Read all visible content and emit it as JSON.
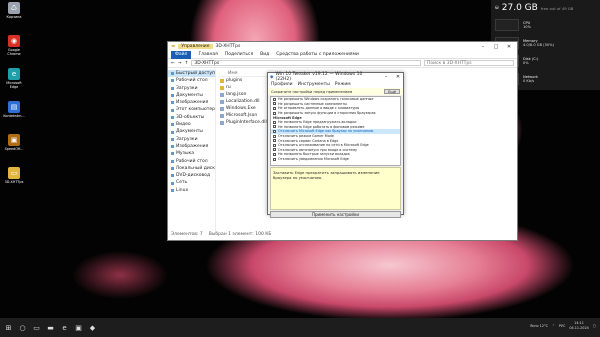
{
  "desktop": {
    "icons": [
      {
        "label": "Корзина",
        "icon": "recycle-bin-icon",
        "color": "#9aa3ad",
        "glyph": "♺"
      },
      {
        "label": "Google Chrome",
        "icon": "chrome-icon",
        "color": "#d93025",
        "glyph": "◉"
      },
      {
        "label": "Microsoft Edge",
        "icon": "edge-icon",
        "color": "#1fa0a8",
        "glyph": "e"
      },
      {
        "label": "Kontekstm...",
        "icon": "app-icon",
        "color": "#2e6fd1",
        "glyph": "▤"
      },
      {
        "label": "SpeedOff...",
        "icon": "app-icon",
        "color": "#b06c12",
        "glyph": "▣"
      },
      {
        "label": "3D-XHTTps",
        "icon": "folder-icon",
        "color": "#e2b63c",
        "glyph": "▭"
      }
    ]
  },
  "widget": {
    "disk_free": "27.0 GB",
    "disk_caption": "free out of 49 GB",
    "cpu_label": "CPU",
    "cpu_value": "10%",
    "memory_label": "Memory",
    "memory_value": "4.0/8.0 GB (50%)",
    "disk_label": "Disk (C:)",
    "disk_value": "0%",
    "network_label": "Network",
    "network_value": "0 Kb/s",
    "accent": "#b86bd6"
  },
  "explorer": {
    "title": "3D-XHTTps",
    "tab_manage": "Управление",
    "ribbon": [
      "Файл",
      "Главная",
      "Поделиться",
      "Вид",
      "Средства работы с приложениями"
    ],
    "address": "3D-XHTTps",
    "search_placeholder": "Поиск в 3D-XHTTps",
    "nav": [
      "Быстрый доступ",
      "Рабочий стол",
      "Загрузки",
      "Документы",
      "Изображения",
      "Этот компьютер",
      "3D-объекты",
      "Видео",
      "Документы",
      "Загрузки",
      "Изображения",
      "Музыка",
      "Рабочий стол",
      "Локальный диск",
      "DVD-дисковод",
      "Сеть",
      "Linux"
    ],
    "files_header": "Имя",
    "files": [
      "plugins",
      "ru",
      "lang.json",
      "Localization.dll",
      "Windows.Exe",
      "Microsoft.Json",
      "PluginInterface.dll"
    ],
    "status_count": "Элементов: 7",
    "status_selected": "Выбран 1 элемент: 100 КБ"
  },
  "dialog": {
    "title": "Win 10 Tweaker v19.12 — Windows 10 (22H2)",
    "menu": [
      "Профили",
      "Инструменты",
      "Режим"
    ],
    "hint": "Сохраните настройки перед применением",
    "hint_button": "Ещё",
    "options": [
      {
        "text": "Не разрешать Windows сохранять голосовые данные",
        "type": "opt"
      },
      {
        "text": "Не разрешать системные компоненты",
        "type": "opt"
      },
      {
        "text": "Не отправлять данные о вводе с клавиатуры",
        "type": "opt"
      },
      {
        "text": "Не разрешать запуск функции в сторонних браузерах",
        "type": "opt"
      },
      {
        "text": "Microsoft Edge",
        "type": "head"
      },
      {
        "text": "Не позволять Edge предзагружать вкладки",
        "type": "opt"
      },
      {
        "text": "Не позволять Edge работать в фоновом режиме",
        "type": "opt"
      },
      {
        "text": "Отключить Microsoft Edge как браузер по умолчанию",
        "type": "hl"
      },
      {
        "text": "Отключить режим Gamer Mode",
        "type": "opt"
      },
      {
        "text": "Отключить сервис Cortana в Edge",
        "type": "opt"
      },
      {
        "text": "Отключить отслеживание по сети в Microsoft Edge",
        "type": "opt"
      },
      {
        "text": "Отключить автозапуск при входе в систему",
        "type": "opt"
      },
      {
        "text": "Не позволять быстрые запуски вкладок",
        "type": "opt"
      },
      {
        "text": "Отключить уведомления Microsoft Edge",
        "type": "opt"
      }
    ],
    "description": "Заставить Edge прекратить запрашивать изменение браузера по умолчанию.",
    "apply": "Применить настройки"
  },
  "taskbar": {
    "items": [
      {
        "name": "start-button",
        "icon": "windows-icon",
        "glyph": "⊞"
      },
      {
        "name": "search-button",
        "icon": "search-icon",
        "glyph": "○"
      },
      {
        "name": "task-view-button",
        "icon": "task-view-icon",
        "glyph": "▭"
      },
      {
        "name": "explorer-button",
        "icon": "folder-icon",
        "glyph": "▬"
      },
      {
        "name": "edge-button",
        "icon": "edge-icon",
        "glyph": "e"
      },
      {
        "name": "store-button",
        "icon": "store-icon",
        "glyph": "▣"
      },
      {
        "name": "tweaker-button",
        "icon": "app-icon",
        "glyph": "◆"
      }
    ],
    "tray_weather": "Ясно 12°C",
    "tray_lang": "РУС",
    "time": "14:11",
    "date": "04.11.2024"
  }
}
